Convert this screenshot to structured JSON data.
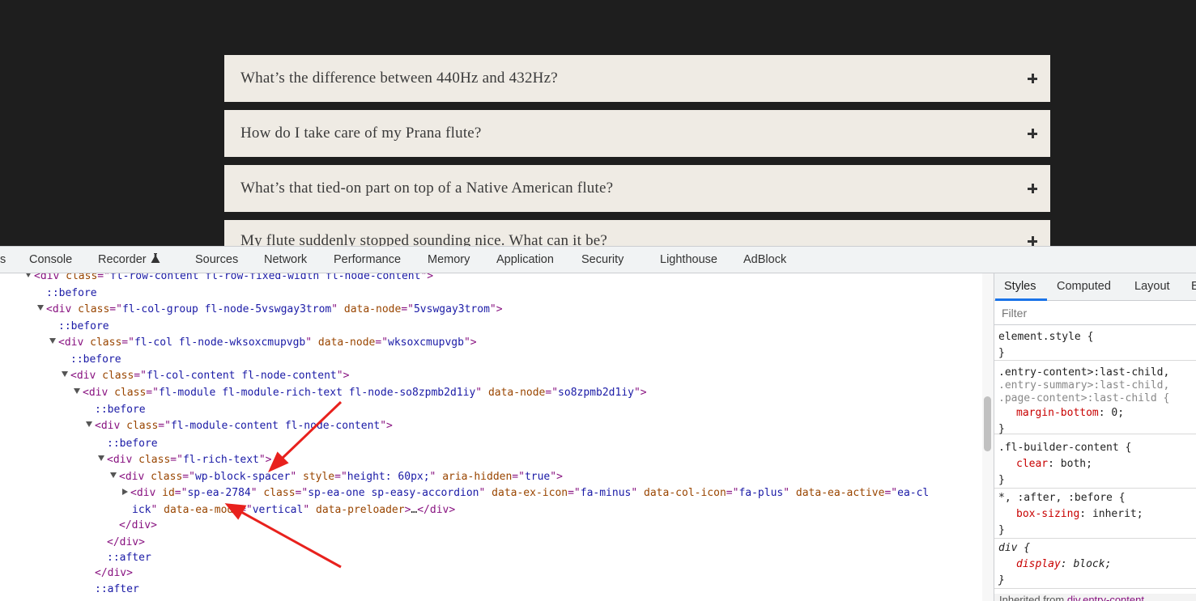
{
  "faq": [
    {
      "question": "What’s the difference between 440Hz and 432Hz?"
    },
    {
      "question": "How do I take care of my Prana flute?"
    },
    {
      "question": "What’s that tied-on part on top of a Native American flute?"
    },
    {
      "question": "My flute suddenly stopped sounding nice. What can it be?"
    }
  ],
  "devtools": {
    "tabs": [
      "s",
      "Console",
      "Recorder",
      "Sources",
      "Network",
      "Performance",
      "Memory",
      "Application",
      "Security",
      "Lighthouse",
      "AdBlock"
    ]
  },
  "dom": {
    "l0": {
      "tag_open": "<div ",
      "attr": "class",
      "eq": "=\"",
      "val": "fl-row-content fl-row-fixed-width fl-node-content",
      "close": "\">"
    },
    "l1": {
      "text": "::before"
    },
    "l2": {
      "tag_open": "<div ",
      "attr1": "class",
      "val1": "fl-col-group fl-node-5vswgay3trom",
      "attr2": "data-node",
      "val2": "5vswgay3trom",
      "close": "\">"
    },
    "l3": {
      "text": "::before"
    },
    "l4": {
      "tag_open": "<div ",
      "attr1": "class",
      "val1": "fl-col fl-node-wksoxcmupvgb",
      "attr2": "data-node",
      "val2": "wksoxcmupvgb",
      "close": "\">"
    },
    "l5": {
      "text": "::before"
    },
    "l6": {
      "tag_open": "<div ",
      "attr1": "class",
      "val1": "fl-col-content fl-node-content",
      "close": "\">"
    },
    "l7": {
      "tag_open": "<div ",
      "attr1": "class",
      "val1": "fl-module fl-module-rich-text fl-node-so8zpmb2d1iy",
      "attr2": "data-node",
      "val2": "so8zpmb2d1iy",
      "close": "\">"
    },
    "l8": {
      "text": "::before"
    },
    "l9": {
      "tag_open": "<div ",
      "attr1": "class",
      "val1": "fl-module-content fl-node-content",
      "close": "\">"
    },
    "l10": {
      "text": "::before"
    },
    "l11": {
      "tag_open": "<div ",
      "attr1": "class",
      "val1": "fl-rich-text",
      "close": "\">"
    },
    "l12": {
      "tag_open": "<div ",
      "attr1": "class",
      "val1": "wp-block-spacer",
      "attr2": "style",
      "val2": "height: 60px;",
      "attr3": "aria-hidden",
      "val3": "true",
      "close": "\">"
    },
    "l13": {
      "tag_open": "<div ",
      "attr1": "id",
      "val1": "sp-ea-2784",
      "attr2": "class",
      "val2": "sp-ea-one sp-easy-accordion",
      "attr3": "data-ex-icon",
      "val3": "fa-minus",
      "attr4": "data-col-icon",
      "val4": "fa-plus",
      "attr5": "data-ea-active",
      "val5": "ea-cl"
    },
    "l14": {
      "val5b": "ick",
      "attr6": "data-ea-mode",
      "val6": "vertical",
      "attr7": "data-preloader",
      "close": ">",
      "ellipsis": "…",
      "end": "</div>"
    },
    "l15": {
      "text": "</div>"
    },
    "l16": {
      "text": "</div>"
    },
    "l17": {
      "text": "::after"
    },
    "l18": {
      "text": "</div>"
    },
    "l19": {
      "text": "::after"
    }
  },
  "styles_pane": {
    "tabs": [
      "Styles",
      "Computed",
      "Layout",
      "E"
    ],
    "filter_placeholder": "Filter",
    "rules": {
      "r0": {
        "selector": "element.style {",
        "end": "}"
      },
      "r1": {
        "sel1": ".entry-content>:last-child,",
        "sel2": ".entry-summary>:last-child,",
        "sel3": ".page-content>:last-child {",
        "prop": "margin-bottom",
        "value": "0;",
        "end": "}"
      },
      "r2": {
        "selector": ".fl-builder-content {",
        "prop": "clear",
        "value": "both;",
        "end": "}"
      },
      "r3": {
        "selector": "*, :after, :before {",
        "prop": "box-sizing",
        "value": "inherit;",
        "end": "}"
      },
      "r4": {
        "selector": "div {",
        "prop": "display",
        "value": "block;",
        "end": "}"
      }
    },
    "inherited_label": "Inherited from",
    "inherited_target": "div.entry-content"
  },
  "colors": {
    "page_bg": "#1e1e1e",
    "faq_bg": "#efebe4",
    "annotation": "#e8211d",
    "tag": "#881280",
    "attr_name": "#994500",
    "attr_value": "#1a1aa6"
  }
}
